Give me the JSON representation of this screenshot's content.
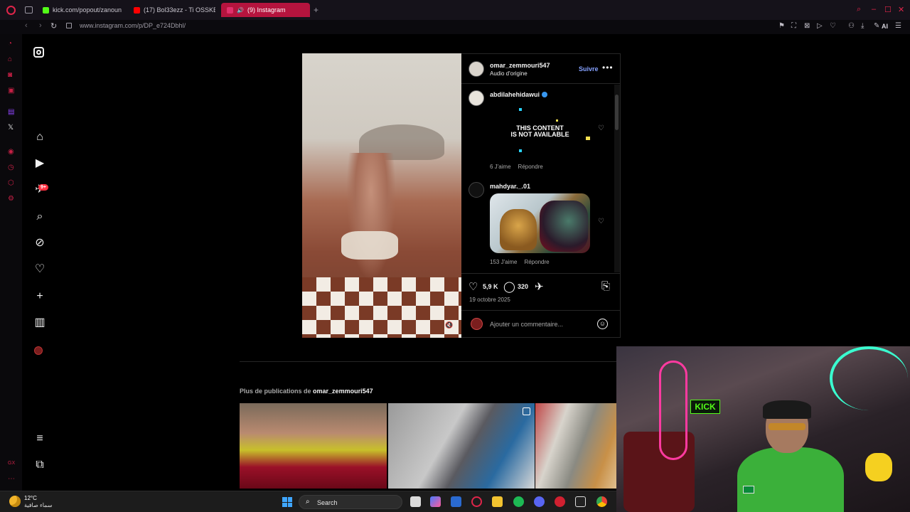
{
  "browser": {
    "tabs": [
      {
        "label": "kick.com/popout/zanoun",
        "color": "#53fc18"
      },
      {
        "label": "(17) Bol33ezz - Ti OSSKE",
        "color": "#ff0000"
      },
      {
        "label": "(9) Instagram",
        "color": "#e1306c"
      }
    ],
    "url": "www.instagram.com/p/DP_e724Dbhl/",
    "ai_label": "AI"
  },
  "ig_nav": {
    "notifications_badge": "9+"
  },
  "post": {
    "author": "omar_zemmouri547",
    "audio": "Audio d'origine",
    "follow_label": "Suivre",
    "comments": [
      {
        "user": "abdilahehidawui",
        "verified": true,
        "media_text_line1": "THIS CONTENT",
        "media_text_line2": "IS NOT AVAILABLE",
        "likes": "6 J'aime",
        "reply": "Répondre"
      },
      {
        "user": "mahdyar._.01",
        "likes": "153 J'aime",
        "reply": "Répondre"
      }
    ],
    "like_count": "5,9 K",
    "comment_count": "320",
    "date": "19 octobre 2025",
    "add_comment_placeholder": "Ajouter un commentaire..."
  },
  "more_posts": {
    "prefix": "Plus de publications de",
    "user": "omar_zemmouri547"
  },
  "taskbar": {
    "temperature": "12°C",
    "weather_desc": "سماء صافية",
    "search_label": "Search"
  },
  "webcam": {
    "sign_text": "KICK"
  },
  "colors": {
    "accent": "#b5143e",
    "ig_blue": "#85a1ff",
    "kick_green": "#53fc18"
  }
}
